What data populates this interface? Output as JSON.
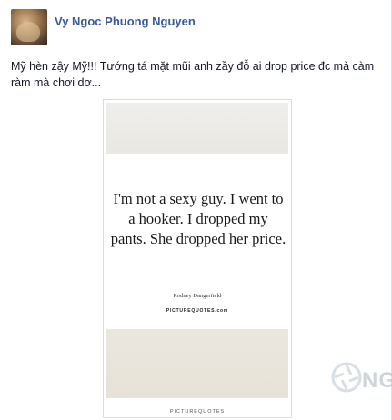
{
  "post": {
    "author_name": "Vy Ngoc Phuong Nguyen",
    "text": "Mỹ hèn zậy Mỹ!!! Tướng tá mặt mũi anh zầy đỗ ai drop price đc mà càm ràm mà chơi dơ..."
  },
  "photo": {
    "quote": "I'm not a sexy guy. I went to a hooker. I dropped my pants. She dropped her price.",
    "quote_author": "Rodney Dangerfield",
    "site": "PICTUREQUOTES.com",
    "site_bottom": "PICTUREQUOTES"
  },
  "watermark": {
    "text": "NG",
    "icon": "camera-aperture-icon"
  }
}
